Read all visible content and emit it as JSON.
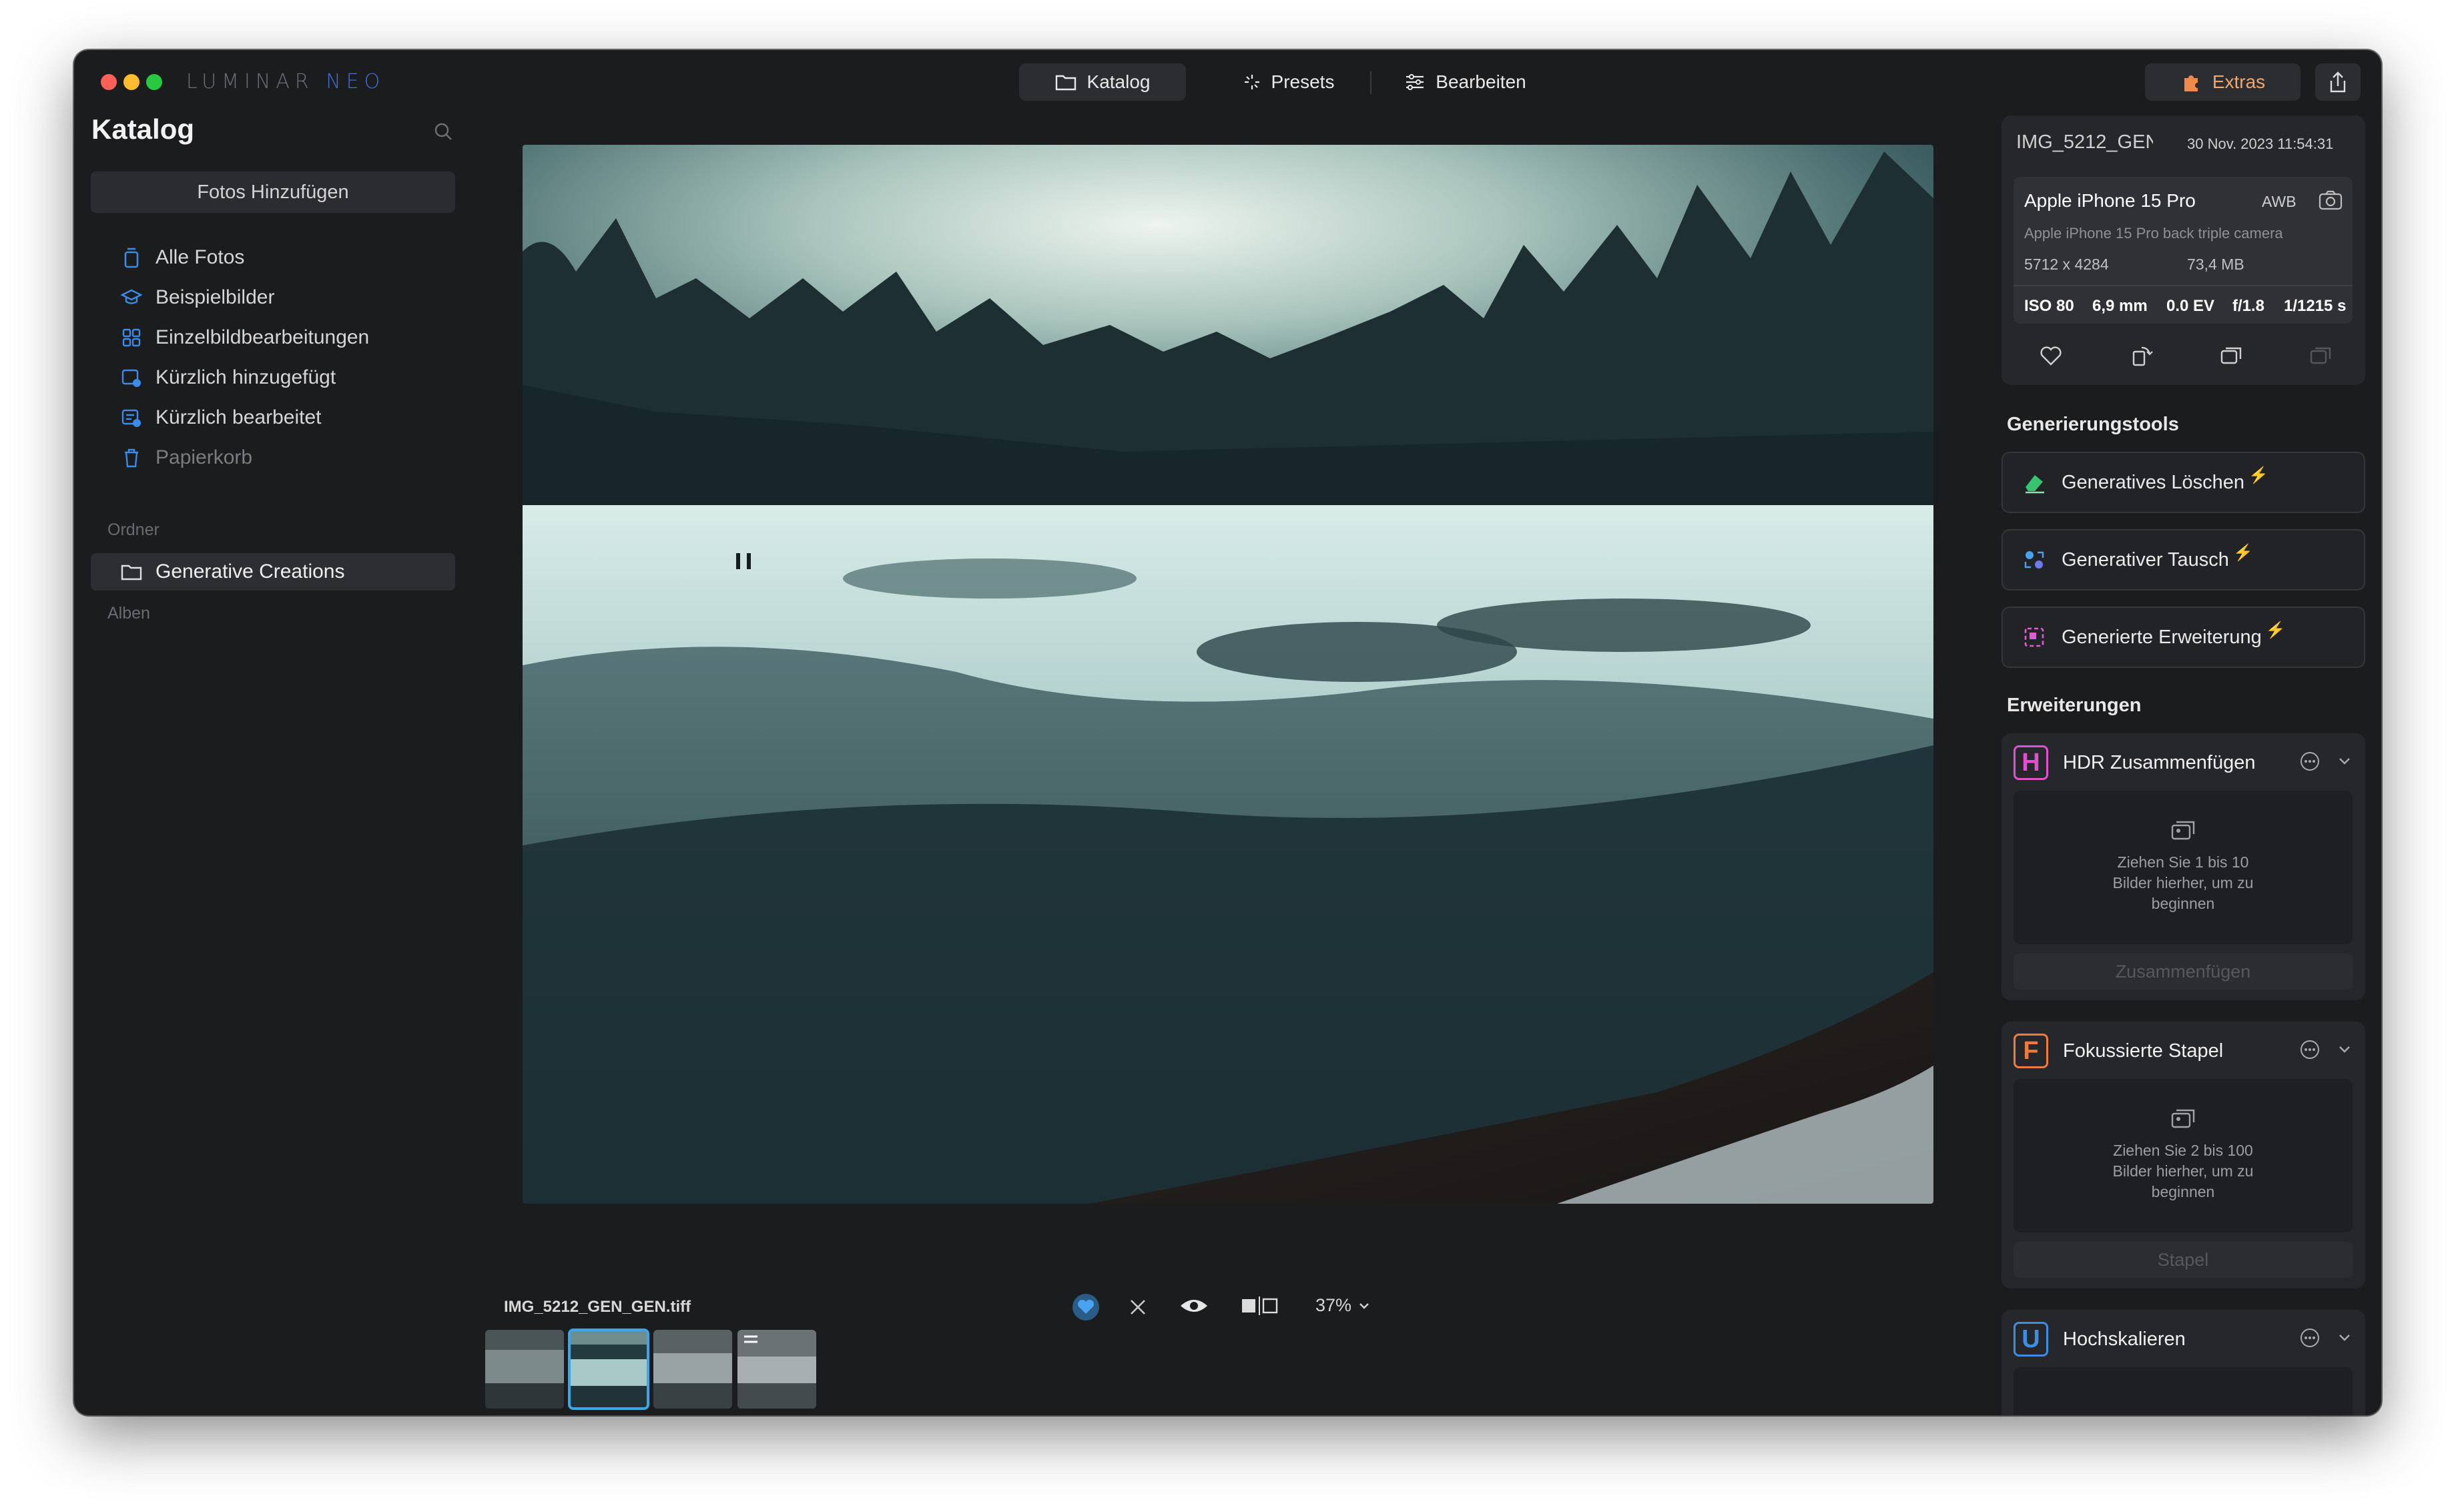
{
  "app": {
    "logo_text": "LUMINAR",
    "logo_neo": "NEO"
  },
  "topbar": {
    "tabs": [
      {
        "label": "Katalog",
        "icon": "folder-icon",
        "active": true
      },
      {
        "label": "Presets",
        "icon": "sparkle-icon",
        "active": false
      },
      {
        "label": "Bearbeiten",
        "icon": "sliders-icon",
        "active": false
      }
    ],
    "extras_label": "Extras",
    "extras_icon": "puzzle-icon",
    "share_icon": "share-icon"
  },
  "sidebar": {
    "title": "Katalog",
    "add_button": "Fotos Hinzufügen",
    "items": [
      {
        "label": "Alle Fotos",
        "icon": "photos-icon"
      },
      {
        "label": "Beispielbilder",
        "icon": "graduation-cap-icon"
      },
      {
        "label": "Einzelbildbearbeitungen",
        "icon": "grid-icon"
      },
      {
        "label": "Kürzlich hinzugefügt",
        "icon": "recent-added-icon"
      },
      {
        "label": "Kürzlich bearbeitet",
        "icon": "recent-edited-icon"
      },
      {
        "label": "Papierkorb",
        "icon": "trash-icon"
      }
    ],
    "folders_label": "Ordner",
    "folders": [
      {
        "label": "Generative Creations",
        "icon": "folder-icon",
        "selected": true
      }
    ],
    "albums_label": "Alben"
  },
  "viewer": {
    "filename": "IMG_5212_GEN_GEN.tiff",
    "zoom": "37%",
    "thumbnails_count": 4,
    "selected_thumbnail": 2
  },
  "info": {
    "file_short": "IMG_5212_GEN",
    "datetime": "30 Nov. 2023 11:54:31",
    "camera": "Apple iPhone 15 Pro",
    "wb": "AWB",
    "lens": "Apple iPhone 15 Pro back triple camera",
    "dimensions": "5712 x 4284",
    "filesize": "73,4 MB",
    "iso": "ISO 80",
    "focal": "6,9 mm",
    "ev": "0.0 EV",
    "aperture": "f/1.8",
    "shutter": "1/1215 s"
  },
  "generation_tools": {
    "title": "Generierungstools",
    "items": [
      {
        "label": "Generatives Löschen",
        "icon": "eraser-icon"
      },
      {
        "label": "Generativer Tausch",
        "icon": "swap-icon"
      },
      {
        "label": "Generierte Erweiterung",
        "icon": "expand-icon"
      }
    ]
  },
  "extensions": {
    "title": "Erweiterungen",
    "items": [
      {
        "letter": "H",
        "label": "HDR Zusammenfügen",
        "drop_text": "Ziehen Sie 1 bis 10 Bilder hierher, um zu beginnen",
        "button": "Zusammenfügen",
        "color": "#e24fd0"
      },
      {
        "letter": "F",
        "label": "Fokussierte Stapel",
        "drop_text": "Ziehen Sie 2 bis 100 Bilder hierher, um zu beginnen",
        "button": "Stapel",
        "color": "#f07a3a"
      },
      {
        "letter": "U",
        "label": "Hochskalieren",
        "color": "#3b8ee8"
      }
    ]
  },
  "colors": {
    "accent": "#3aa7e6",
    "close": "#ff5f57",
    "minimize": "#febc2e",
    "zoom": "#28c840",
    "bolt": "#3fd07a"
  }
}
